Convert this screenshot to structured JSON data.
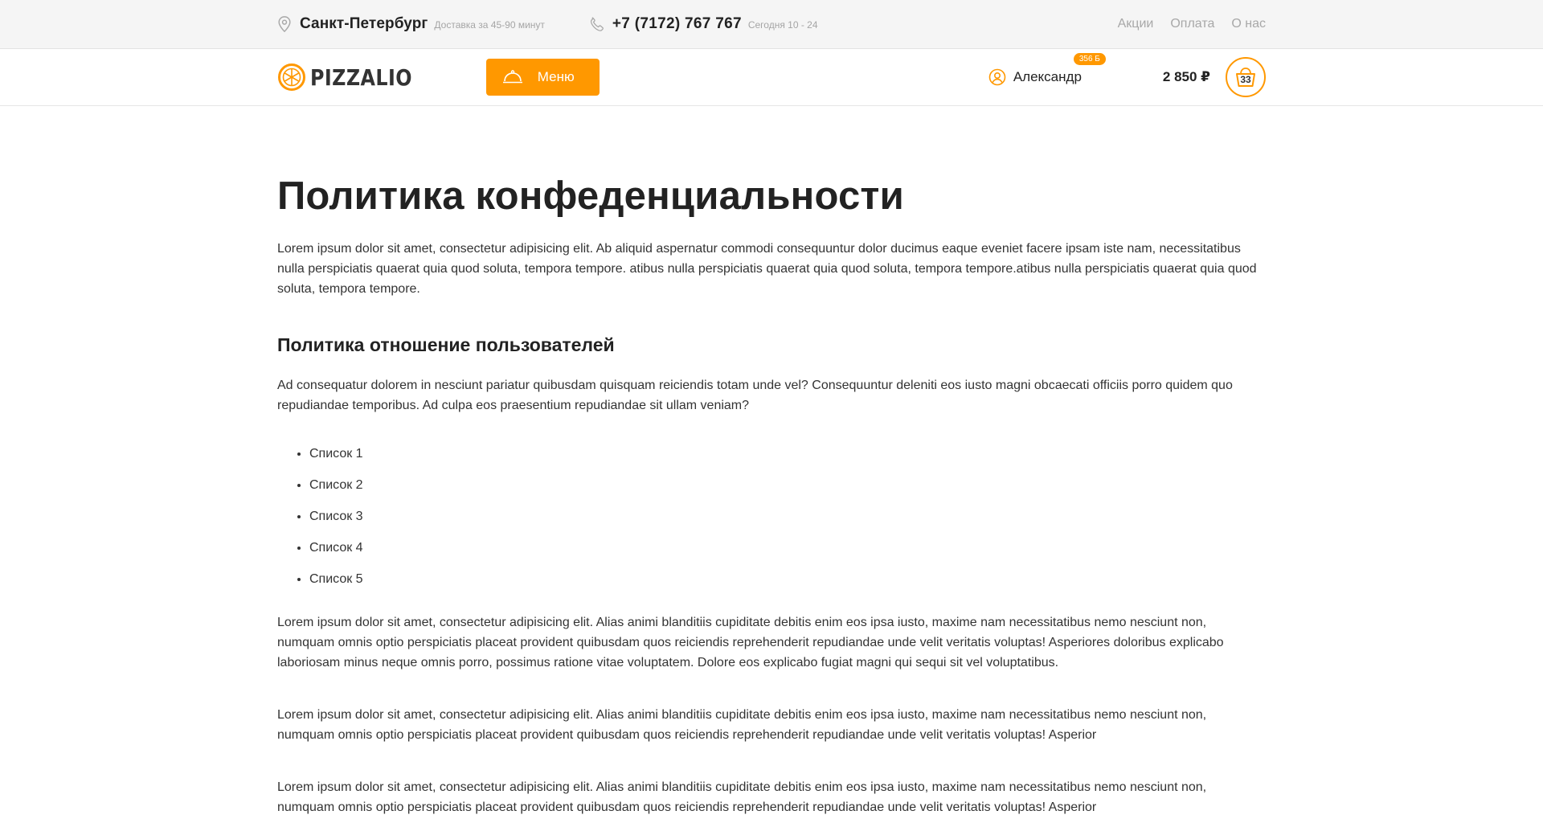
{
  "topbar": {
    "city": "Санкт-Петербург",
    "delivery_note": "Доставка за 45-90 минут",
    "phone": "+7 (7172) 767 767",
    "hours": "Сегодня 10 - 24",
    "links": [
      "Акции",
      "Оплата",
      "О нас"
    ]
  },
  "header": {
    "logo_text": "PIZZALIO",
    "menu_label": "Меню",
    "user_name": "Александр",
    "bonus": "356 Б",
    "cart_total": "2 850 ₽",
    "cart_count": "33"
  },
  "content": {
    "title": "Политика конфеденциальности",
    "intro": "Lorem ipsum dolor sit amet, consectetur adipisicing elit. Ab aliquid aspernatur commodi consequuntur dolor ducimus eaque eveniet facere ipsam iste nam, necessitatibus nulla perspiciatis quaerat quia quod soluta, tempora tempore. atibus nulla perspiciatis quaerat quia quod soluta, tempora tempore.atibus nulla perspiciatis quaerat quia quod soluta, tempora tempore.",
    "subtitle": "Политика отношение пользователей",
    "sub_para": "Ad consequatur dolorem in nesciunt pariatur quibusdam quisquam reiciendis totam unde vel? Consequuntur deleniti eos iusto magni obcaecati officiis porro quidem quo repudiandae temporibus. Ad culpa eos praesentium repudiandae sit ullam veniam?",
    "list": [
      "Список 1",
      "Список 2",
      "Список 3",
      "Список 4",
      "Список 5"
    ],
    "para_1": "Lorem ipsum dolor sit amet, consectetur adipisicing elit. Alias animi blanditiis cupiditate debitis enim eos ipsa iusto, maxime nam necessitatibus nemo nesciunt non, numquam omnis optio perspiciatis placeat provident quibusdam quos reiciendis reprehenderit repudiandae unde velit veritatis voluptas! Asperiores doloribus explicabo laboriosam minus neque omnis porro, possimus ratione vitae voluptatem. Dolore eos explicabo fugiat magni qui sequi sit vel voluptatibus.",
    "para_2": "Lorem ipsum dolor sit amet, consectetur adipisicing elit. Alias animi blanditiis cupiditate debitis enim eos ipsa iusto, maxime nam necessitatibus nemo nesciunt non, numquam omnis optio perspiciatis placeat provident quibusdam quos reiciendis reprehenderit repudiandae unde velit veritatis voluptas! Asperior",
    "para_3": "Lorem ipsum dolor sit amet, consectetur adipisicing elit. Alias animi blanditiis cupiditate debitis enim eos ipsa iusto, maxime nam necessitatibus nemo nesciunt non, numquam omnis optio perspiciatis placeat provident quibusdam quos reiciendis reprehenderit repudiandae unde velit veritatis voluptas! Asperior"
  },
  "icons": {
    "location": "location-pin-icon",
    "phone": "phone-icon",
    "logo": "pizza-logo-icon",
    "menu": "cloche-icon",
    "user": "user-icon",
    "cart": "basket-icon"
  },
  "colors": {
    "accent": "#ff9800",
    "topbar_bg": "#f5f5f5",
    "text": "#222222",
    "muted": "#a8a8a8"
  }
}
